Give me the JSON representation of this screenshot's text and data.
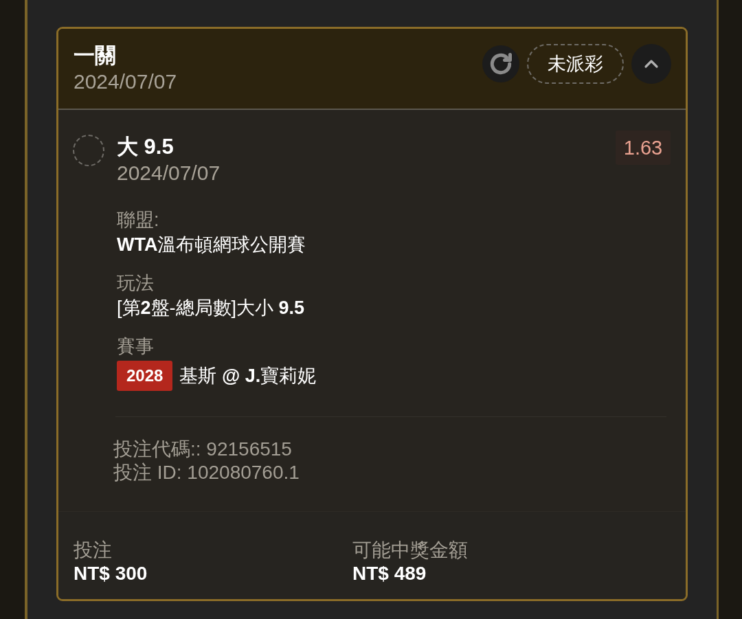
{
  "header": {
    "title": "一關",
    "date": "2024/07/07",
    "status": "未派彩",
    "expanded": true
  },
  "selection": {
    "selected": false,
    "pick": "大 9.5",
    "date": "2024/07/07",
    "odds": "1.63"
  },
  "details": [
    {
      "kind": "text",
      "label": "聯盟:",
      "value": "**WTA**溫布頓網球公開賽"
    },
    {
      "kind": "text",
      "label": "玩法",
      "value": "[第**2**盤-總局數]大小 **9.5**"
    },
    {
      "kind": "match",
      "label": "賽事",
      "badge": "2028",
      "value": "基斯 **@ J.**寶莉妮"
    }
  ],
  "codes": [
    "投注代碼:: 92156515",
    "投注 ID: 102080760.1"
  ],
  "summary": [
    {
      "label": "投注",
      "value": "NT$ 300"
    },
    {
      "label": "可能中獎金額",
      "value": "NT$ 489"
    }
  ]
}
